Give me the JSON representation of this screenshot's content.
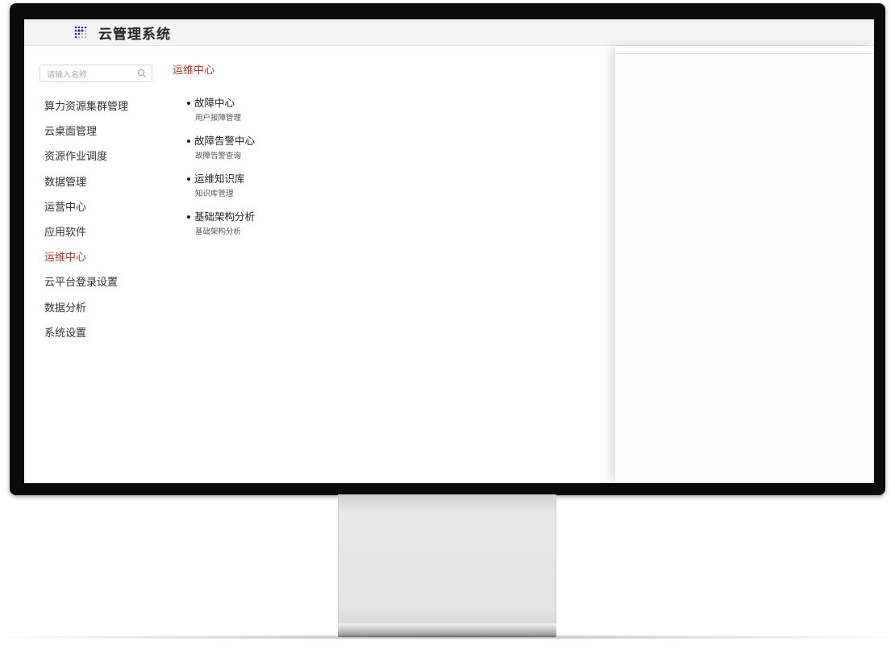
{
  "app": {
    "title": "云管理系统",
    "logo_icon": "grid-dots-logo-icon"
  },
  "search": {
    "placeholder": "请输入名称",
    "icon": "search-icon"
  },
  "sidebar": {
    "items": [
      {
        "label": "算力资源集群管理",
        "active": false
      },
      {
        "label": "云桌面管理",
        "active": false
      },
      {
        "label": "资源作业调度",
        "active": false
      },
      {
        "label": "数据管理",
        "active": false
      },
      {
        "label": "运营中心",
        "active": false
      },
      {
        "label": "应用软件",
        "active": false
      },
      {
        "label": "运维中心",
        "active": true
      },
      {
        "label": "云平台登录设置",
        "active": false
      },
      {
        "label": "数据分析",
        "active": false
      },
      {
        "label": "系统设置",
        "active": false
      }
    ]
  },
  "content": {
    "section_title": "运维中心",
    "groups": [
      {
        "title": "故障中心",
        "items": [
          "用户报障管理"
        ]
      },
      {
        "title": "故障告警中心",
        "items": [
          "故障告警查询"
        ]
      },
      {
        "title": "运维知识库",
        "items": [
          "知识库管理"
        ]
      },
      {
        "title": "基础架构分析",
        "items": [
          "基础架构分析"
        ]
      }
    ]
  },
  "colors": {
    "accent": "#b03a2e",
    "text": "#333333",
    "bezel": "#0b0b0b"
  }
}
